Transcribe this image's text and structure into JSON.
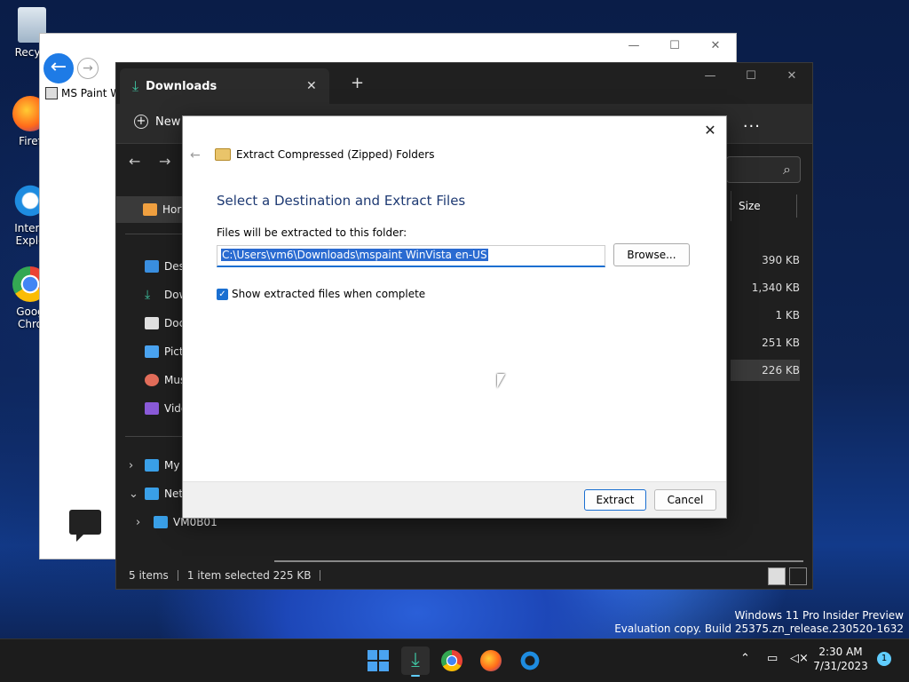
{
  "desktop": {
    "icons": [
      {
        "label": "Recycl"
      },
      {
        "label": "Firef"
      },
      {
        "label": "Intern\nExplo"
      },
      {
        "label": "Goog\nChro"
      }
    ]
  },
  "ie_window": {
    "tab_title": "MS Paint W"
  },
  "explorer": {
    "tab_title": "Downloads",
    "new_label": "New",
    "more_label": "...",
    "sidebar": {
      "home": "Hor",
      "desktop": "Desl",
      "downloads": "Dow",
      "documents": "Doc",
      "pictures": "Pict",
      "music": "Mus",
      "videos": "Vide",
      "this_pc": "My",
      "network": "Netv",
      "vm": "VM0B01"
    },
    "column_size": "Size",
    "sizes": [
      "390 KB",
      "1,340 KB",
      "1 KB",
      "251 KB",
      "226 KB"
    ],
    "status": {
      "items": "5 items",
      "selected": "1 item selected  225 KB"
    }
  },
  "dialog": {
    "wizard_title": "Extract Compressed (Zipped) Folders",
    "heading": "Select a Destination and Extract Files",
    "label": "Files will be extracted to this folder:",
    "path": "C:\\Users\\vm6\\Downloads\\mspaint WinVista en-US",
    "browse": "Browse...",
    "checkbox_label": "Show extracted files when complete",
    "extract": "Extract",
    "cancel": "Cancel"
  },
  "watermark": {
    "line1": "Windows 11 Pro Insider Preview",
    "line2": "Evaluation copy. Build 25375.zn_release.230520-1632"
  },
  "taskbar": {
    "time": "2:30 AM",
    "date": "7/31/2023",
    "notifications": "1"
  }
}
